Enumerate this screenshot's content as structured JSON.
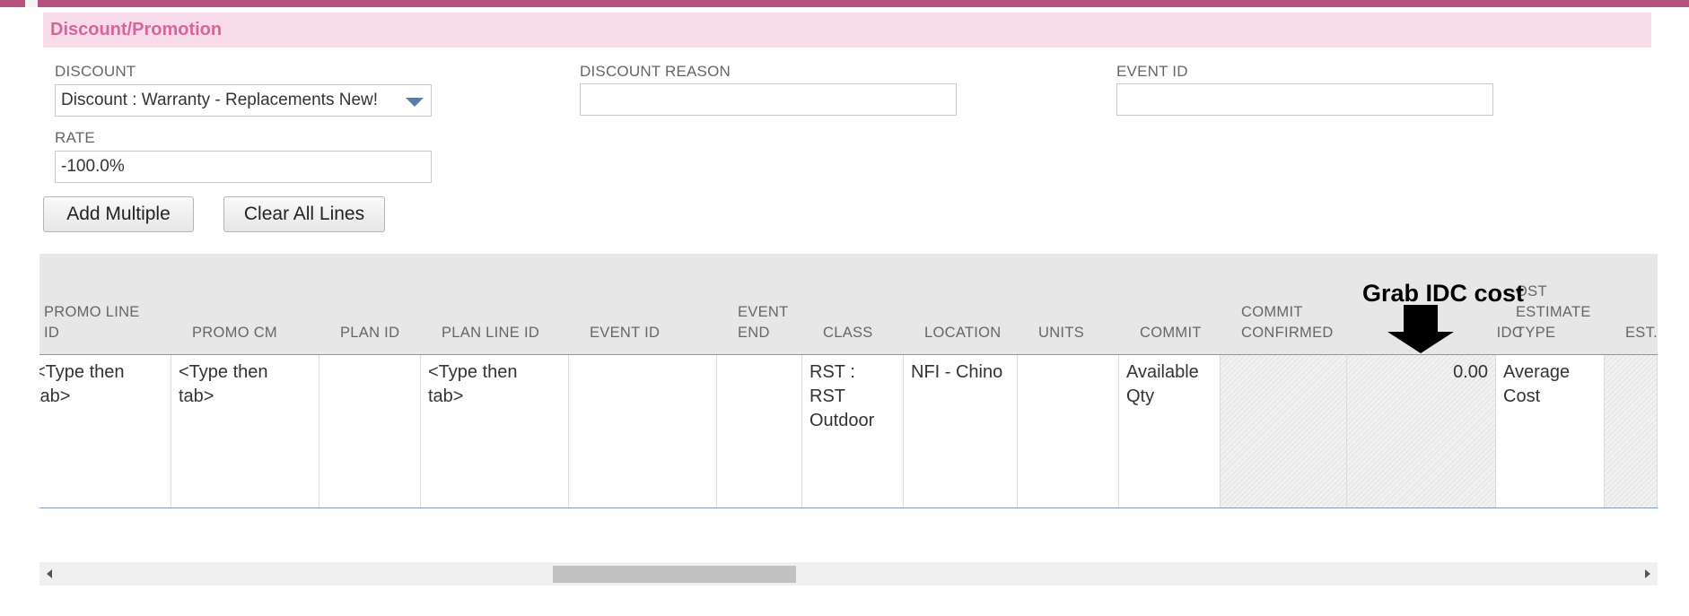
{
  "section": {
    "title": "Discount/Promotion"
  },
  "fields": {
    "discount": {
      "label": "DISCOUNT",
      "value": "Discount : Warranty - Replacements New!"
    },
    "discount_reason": {
      "label": "DISCOUNT REASON",
      "value": ""
    },
    "event_id": {
      "label": "EVENT ID",
      "value": ""
    },
    "rate": {
      "label": "RATE",
      "value": "-100.0%"
    }
  },
  "buttons": {
    "add_multiple": "Add Multiple",
    "clear_all_lines": "Clear All Lines"
  },
  "table": {
    "headers": {
      "promo_line_id": "PROMO LINE\nID",
      "promo_cm": "PROMO CM",
      "plan_id": "PLAN ID",
      "plan_line_id": "PLAN LINE ID",
      "event_id": "EVENT ID",
      "event_end": "EVENT\nEND",
      "class": "CLASS",
      "location": "LOCATION",
      "units": "UNITS",
      "commit": "COMMIT",
      "commit_confirmed": "COMMIT\nCONFIRMED",
      "idc": "IDC",
      "cost_estimate_type": "OST\nESTIMATE\nTYPE",
      "est": "EST."
    },
    "row": {
      "promo_line_id": "<Type then\ntab>",
      "promo_cm": "<Type then\ntab>",
      "plan_id": "",
      "plan_line_id": "<Type then\ntab>",
      "event_id": "",
      "event_end": "",
      "class": "RST : RST\nOutdoor",
      "location": "NFI - Chino",
      "units": "",
      "commit": "Available\nQty",
      "commit_confirmed": "",
      "idc": "0.00",
      "cost_estimate_type": "Average\nCost",
      "est": ""
    }
  },
  "annotation": {
    "text": "Grab IDC cost"
  },
  "colors": {
    "accent": "#b5507f",
    "section_bg": "#f8dce9",
    "section_text": "#d4679a",
    "select_arrow": "#5a7ba8"
  },
  "icons": {
    "select": "chevron-down-icon",
    "scroll_left": "scroll-left-icon",
    "scroll_right": "scroll-right-icon",
    "annotation_arrow": "down-arrow-icon"
  }
}
